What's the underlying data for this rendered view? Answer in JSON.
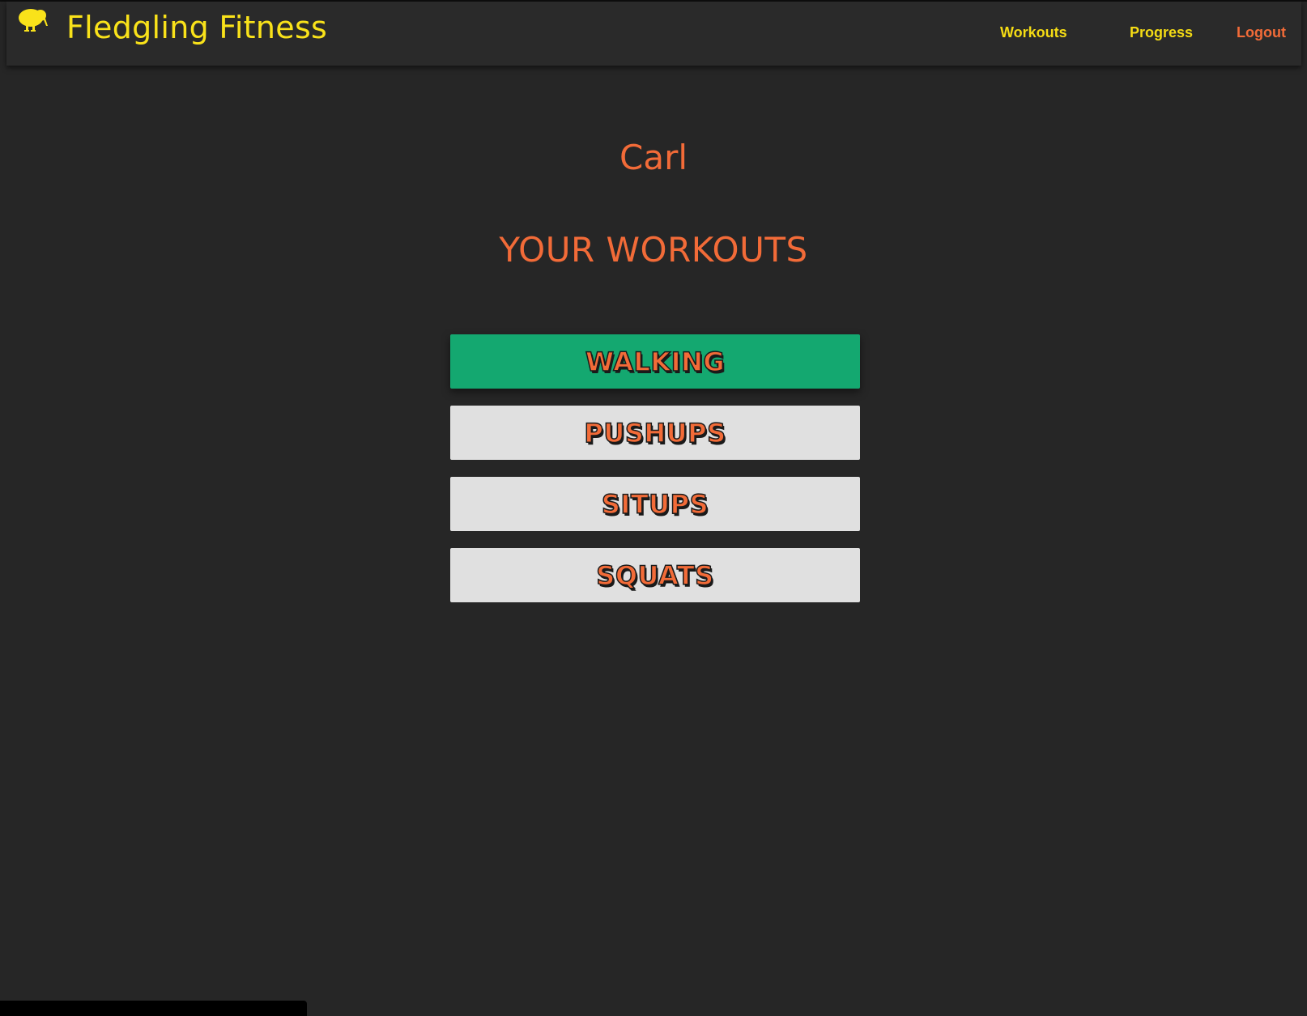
{
  "header": {
    "brand": {
      "icon": "kiwi-bird-icon",
      "title": "Fledgling Fitness"
    },
    "nav": {
      "workouts_label": "Workouts",
      "progress_label": "Progress",
      "logout_label": "Logout"
    }
  },
  "main": {
    "user_name": "Carl",
    "section_title": "YOUR WORKOUTS",
    "workouts": [
      {
        "label": "WALKING",
        "selected": true
      },
      {
        "label": "PUSHUPS",
        "selected": false
      },
      {
        "label": "SITUPS",
        "selected": false
      },
      {
        "label": "SQUATS",
        "selected": false
      }
    ]
  },
  "colors": {
    "background": "#262626",
    "navbar": "#2a2a2a",
    "brand_yellow": "#f9e21a",
    "accent_orange": "#f26b38",
    "selected_green": "#14a870",
    "button_gray": "#e0e0e0"
  }
}
